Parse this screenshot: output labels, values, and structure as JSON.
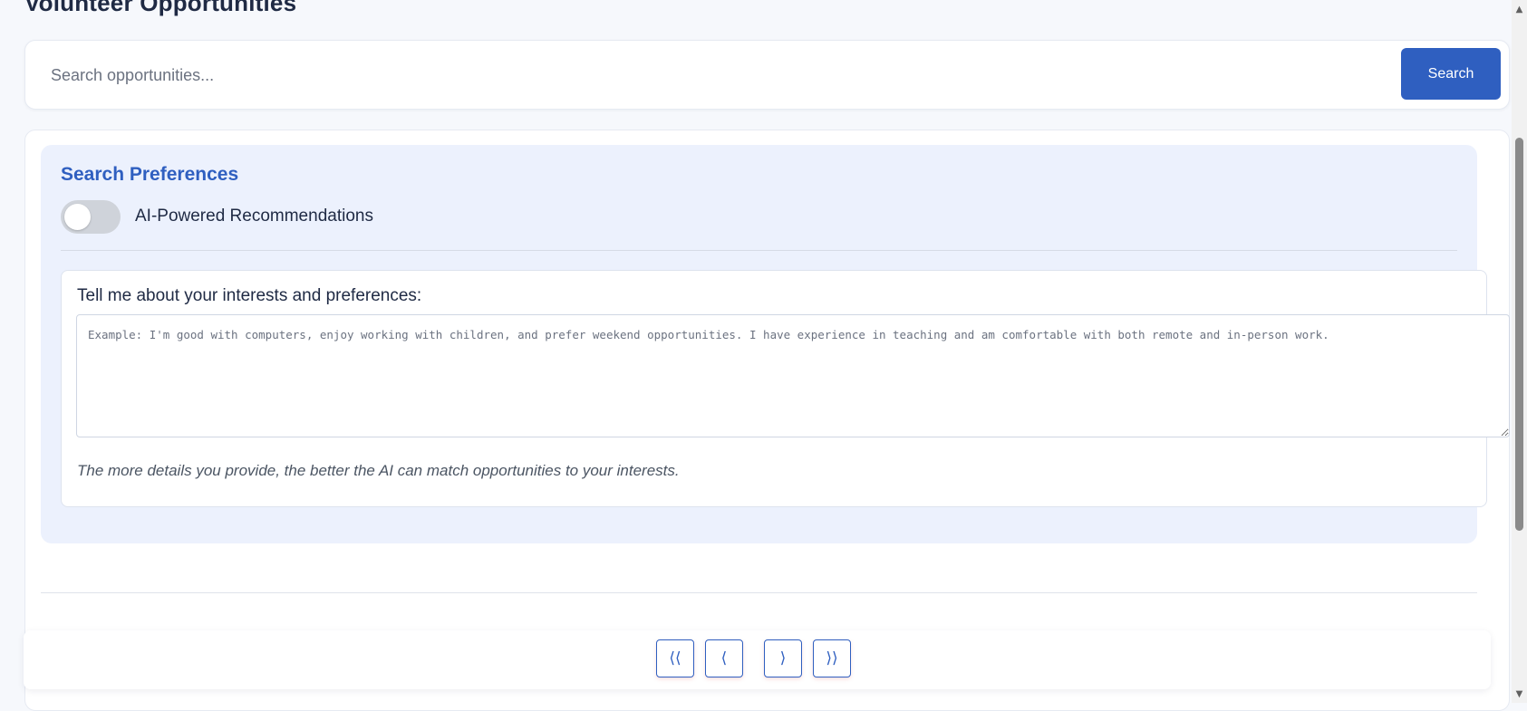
{
  "page": {
    "title": "Volunteer Opportunities"
  },
  "search": {
    "placeholder": "Search opportunities...",
    "button_label": "Search"
  },
  "preferences": {
    "title": "Search Preferences",
    "ai_toggle": {
      "label": "AI-Powered Recommendations",
      "enabled": false
    },
    "interests": {
      "label": "Tell me about your interests and preferences:",
      "placeholder": "Example: I'm good with computers, enjoy working with children, and prefer weekend opportunities. I have experience in teaching and am comfortable with both remote and in-person work.",
      "helper": "The more details you provide, the better the AI can match opportunities to your interests."
    }
  },
  "pagination": {
    "first_label": "⟨⟨",
    "prev_label": "⟨",
    "next_label": "⟩",
    "last_label": "⟩⟩"
  },
  "colors": {
    "accent": "#2f5fc0",
    "panel_bg": "#ecf1fd",
    "page_bg": "#f6f8fc"
  }
}
